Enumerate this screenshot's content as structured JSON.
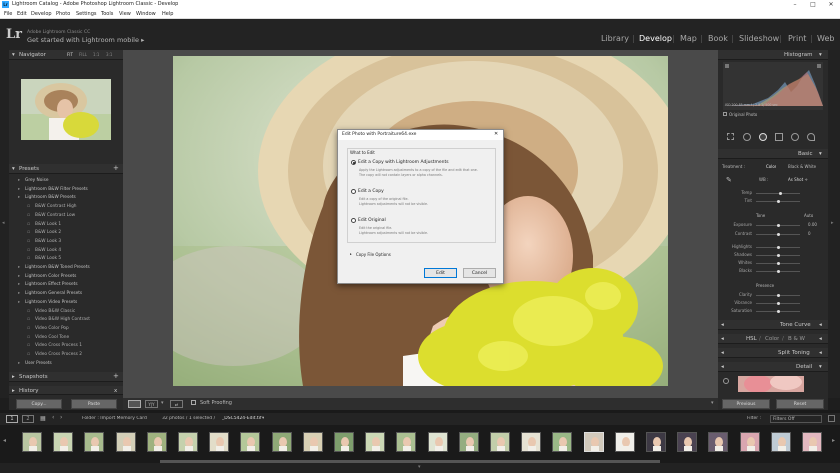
{
  "window": {
    "title": "Lightroom Catalog - Adobe Photoshop Lightroom Classic - Develop",
    "minimize": "–",
    "maximize": "□",
    "close": "✕"
  },
  "menubar": [
    "File",
    "Edit",
    "Develop",
    "Photo",
    "Settings",
    "Tools",
    "View",
    "Window",
    "Help"
  ],
  "identity": {
    "logo": "Lr",
    "subtitle": "Adobe Lightroom Classic CC",
    "main": "Get started with Lightroom mobile",
    "arrow": "▸"
  },
  "modules": [
    {
      "label": "Library"
    },
    {
      "label": "Develop",
      "active": true
    },
    {
      "label": "Map"
    },
    {
      "label": "Book"
    },
    {
      "label": "Slideshow"
    },
    {
      "label": "Print"
    },
    {
      "label": "Web"
    }
  ],
  "navigator": {
    "title": "Navigator",
    "fit": "FIT",
    "fill": "FILL",
    "one": "1:1",
    "three": "3:1"
  },
  "presets": {
    "title": "Presets",
    "plus": "+",
    "items": [
      {
        "label": "Grey Noise",
        "level": 0
      },
      {
        "label": "Lightroom B&W Filter Presets",
        "level": 0
      },
      {
        "label": "Lightroom B&W Presets",
        "level": 0
      },
      {
        "label": "B&W Contrast High",
        "level": 1
      },
      {
        "label": "B&W Contrast Low",
        "level": 1
      },
      {
        "label": "B&W Look 1",
        "level": 1
      },
      {
        "label": "B&W Look 2",
        "level": 1
      },
      {
        "label": "B&W Look 3",
        "level": 1
      },
      {
        "label": "B&W Look 4",
        "level": 1
      },
      {
        "label": "B&W Look 5",
        "level": 1
      },
      {
        "label": "Lightroom B&W Toned Presets",
        "level": 0
      },
      {
        "label": "Lightroom Color Presets",
        "level": 0
      },
      {
        "label": "Lightroom Effect Presets",
        "level": 0
      },
      {
        "label": "Lightroom General Presets",
        "level": 0
      },
      {
        "label": "Lightroom Video Presets",
        "level": 0
      },
      {
        "label": "Video B&W Classic",
        "level": 1
      },
      {
        "label": "Video B&W High Contrast",
        "level": 1
      },
      {
        "label": "Video Color Pop",
        "level": 1
      },
      {
        "label": "Video Cool Tone",
        "level": 1
      },
      {
        "label": "Video Cross Process 1",
        "level": 1
      },
      {
        "label": "Video Cross Process 2",
        "level": 1
      },
      {
        "label": "User Presets",
        "level": 0
      }
    ]
  },
  "snapshots": {
    "title": "Snapshots",
    "plus": "+"
  },
  "history": {
    "title": "History",
    "x": "x"
  },
  "leftbuttons": {
    "copy": "Copy...",
    "paste": "Paste"
  },
  "toolbar": {
    "soft_proofing": "Soft Proofing"
  },
  "histogram": {
    "title": "Histogram",
    "info": "ISO 200   85 mm   f / 2.8   1/ 500 sec",
    "original": "Original Photo"
  },
  "basic": {
    "title": "Basic",
    "treatment": "Treatment :",
    "color": "Color",
    "bw": "Black & White",
    "wb": "WB :",
    "as_shot": "As Shot ÷",
    "temp": "Temp",
    "tint": "Tint",
    "tone": "Tone",
    "auto": "Auto",
    "exposure": "Exposure",
    "exposure_val": "0.00",
    "contrast": "Contrast",
    "contrast_val": "0",
    "highlights": "Highlights",
    "shadows": "Shadows",
    "whites": "Whites",
    "blacks": "Blacks",
    "presence": "Presence",
    "clarity": "Clarity",
    "vibrance": "Vibrance",
    "saturation": "Saturation"
  },
  "tone_curve": "Tone Curve",
  "hsl": {
    "hsl": "HSL",
    "sep1": "/",
    "color": "Color",
    "sep2": "/",
    "bw": "B & W"
  },
  "split_toning": "Split Toning",
  "detail": "Detail",
  "rightbuttons": {
    "previous": "Previous",
    "reset": "Reset"
  },
  "filmstrip": {
    "one": "1",
    "two": "2",
    "source": "Folder : Import Memory Card",
    "count": "32 photos / 1 selected /",
    "file": "_DSC5424-Edit.tif",
    "dropdown": "▾",
    "filter_label": "Filter :",
    "filter_value": "Filters Off"
  },
  "dialog": {
    "title": "Edit Photo with Portraiture64.exe",
    "close": "✕",
    "what": "What to Edit",
    "opt1": "Edit a Copy with Lightroom Adjustments",
    "opt1_desc1": "Apply the Lightroom adjustments to a copy of the file and edit that one.",
    "opt1_desc2": "The copy will not contain layers or alpha channels.",
    "opt2": "Edit a Copy",
    "opt2_desc1": "Edit a copy of the original file.",
    "opt2_desc2": "Lightroom adjustments will not be visible.",
    "opt3": "Edit Original",
    "opt3_desc1": "Edit the original file.",
    "opt3_desc2": "Lightroom adjustments will not be visible.",
    "copy_options": "Copy File Options",
    "edit": "Edit",
    "cancel": "Cancel"
  }
}
